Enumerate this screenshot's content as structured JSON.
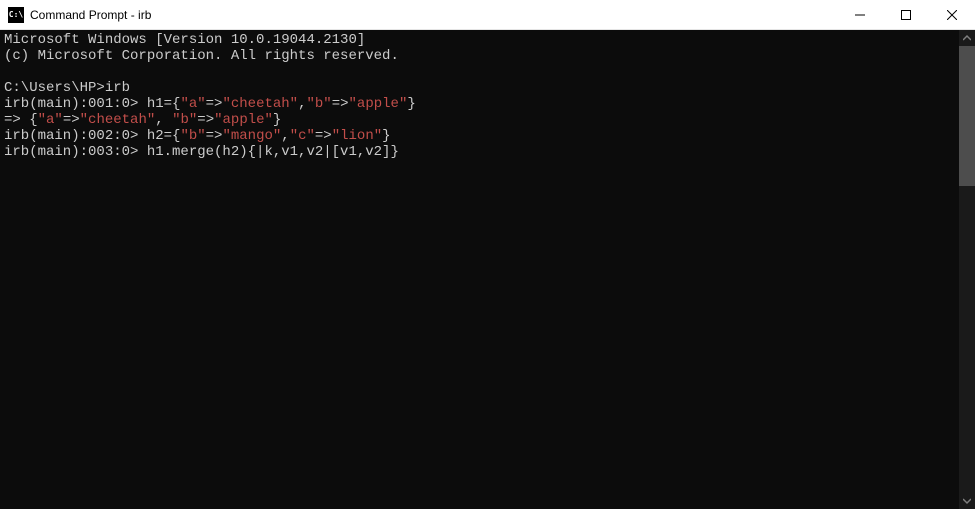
{
  "window": {
    "title": "Command Prompt - irb",
    "icon_label": "C:\\"
  },
  "terminal": {
    "line1": "Microsoft Windows [Version 10.0.19044.2130]",
    "line2": "(c) Microsoft Corporation. All rights reserved.",
    "blank1": "",
    "line3": "C:\\Users\\HP>irb",
    "l4_p1": "irb(main):001:0> h1={",
    "l4_s1": "\"a\"",
    "l4_p2": "=>",
    "l4_s2": "\"cheetah\"",
    "l4_p3": ",",
    "l4_s3": "\"b\"",
    "l4_p4": "=>",
    "l4_s4": "\"apple\"",
    "l4_p5": "}",
    "l5_p1": "=> {",
    "l5_s1": "\"a\"",
    "l5_p2": "=>",
    "l5_s2": "\"cheetah\"",
    "l5_p3": ", ",
    "l5_s3": "\"b\"",
    "l5_p4": "=>",
    "l5_s4": "\"apple\"",
    "l5_p5": "}",
    "l6_p1": "irb(main):002:0> h2={",
    "l6_s1": "\"b\"",
    "l6_p2": "=>",
    "l6_s2": "\"mango\"",
    "l6_p3": ",",
    "l6_s3": "\"c\"",
    "l6_p4": "=>",
    "l6_s4": "\"lion\"",
    "l6_p5": "}",
    "l7": "irb(main):003:0> h1.merge(h2){|k,v1,v2|[v1,v2]}"
  }
}
